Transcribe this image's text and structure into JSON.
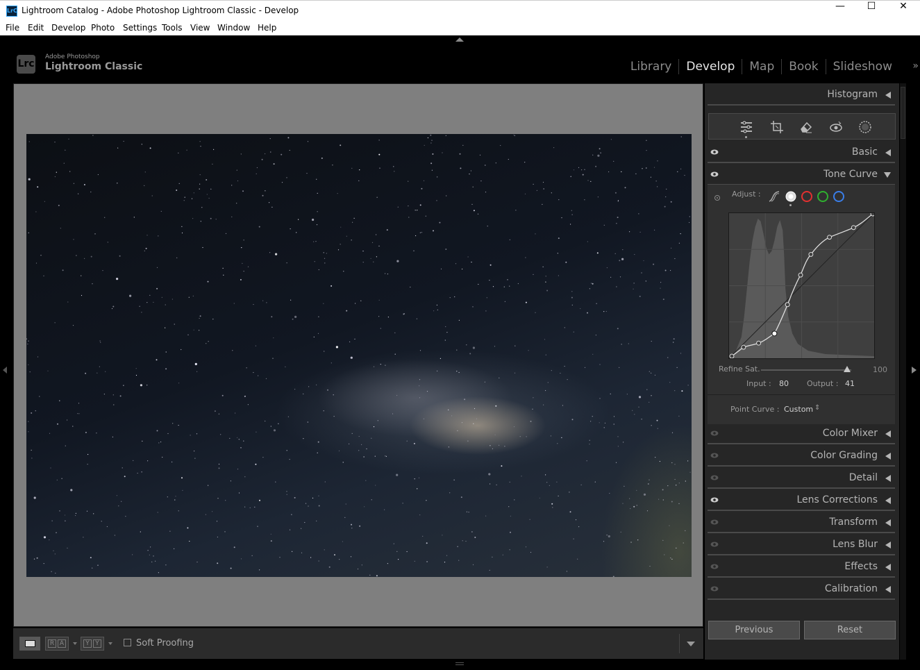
{
  "window": {
    "app_icon_label": "LrC",
    "title": "Lightroom Catalog - Adobe Photoshop Lightroom Classic - Develop",
    "minimize": "—",
    "maximize": "☐",
    "close": "✕"
  },
  "menu": [
    "File",
    "Edit",
    "Develop",
    "Photo",
    "Settings",
    "Tools",
    "View",
    "Window",
    "Help"
  ],
  "brand": {
    "logo": "Lrc",
    "small": "Adobe Photoshop",
    "big": "Lightroom Classic"
  },
  "modules": {
    "items": [
      "Library",
      "Develop",
      "Map",
      "Book",
      "Slideshow"
    ],
    "active": "Develop",
    "more": "»"
  },
  "toolbar": {
    "soft_proofing_label": "Soft Proofing",
    "soft_proofing_checked": false
  },
  "right_panel": {
    "histogram": "Histogram",
    "basic": "Basic",
    "tone_curve": {
      "title": "Tone Curve",
      "adjust_label": "Adjust :",
      "refine_sat_label": "Refine Sat.",
      "refine_sat_value": "100",
      "refine_sat_fraction": 0.95,
      "input_label": "Input :",
      "input_value": "80",
      "output_label": "Output :",
      "output_value": "41",
      "point_curve_label": "Point Curve :",
      "point_curve_value": "Custom",
      "point_curve_arrows": "⇕"
    },
    "sections": [
      "Color Mixer",
      "Color Grading",
      "Detail",
      "Lens Corrections",
      "Transform",
      "Lens Blur",
      "Effects",
      "Calibration"
    ],
    "previous_button": "Previous",
    "reset_button": "Reset"
  },
  "colors": {
    "active_module": "#e6e6e6",
    "inactive_module": "#8c8c8c",
    "panel_bg": "#262626",
    "curve_red": "#e23030",
    "curve_green": "#2fb02f",
    "curve_blue": "#3a7ee8"
  }
}
